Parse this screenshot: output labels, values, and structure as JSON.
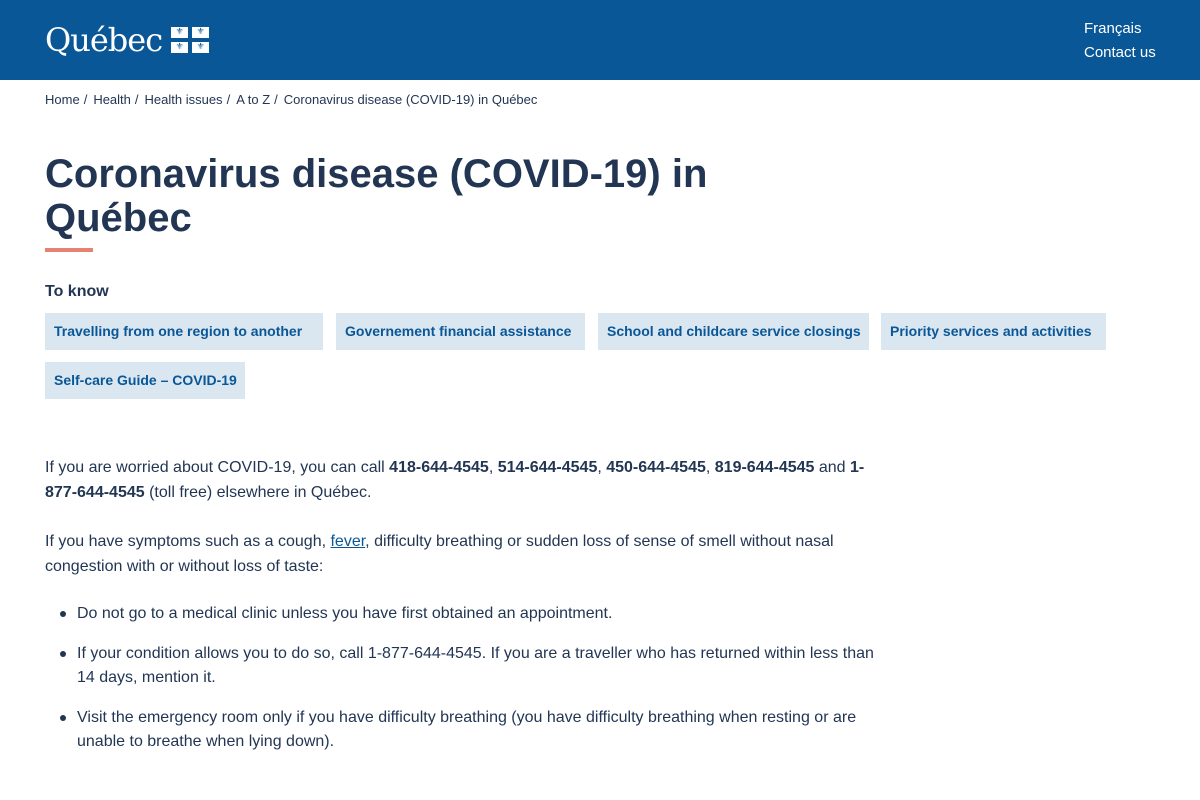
{
  "header": {
    "logo_text": "Québec",
    "links": [
      {
        "label": "Français"
      },
      {
        "label": "Contact us"
      }
    ]
  },
  "breadcrumb": [
    {
      "label": "Home"
    },
    {
      "label": "Health"
    },
    {
      "label": "Health issues"
    },
    {
      "label": "A to Z"
    },
    {
      "label": "Coronavirus disease (COVID-19) in Québec"
    }
  ],
  "breadcrumb_separator": "/",
  "page": {
    "title": "Coronavirus disease (COVID-19) in Québec",
    "to_know_heading": "To know",
    "quick_links": [
      {
        "label": "Travelling from one region to another"
      },
      {
        "label": "Governement financial assistance"
      },
      {
        "label": "School and childcare service closings"
      },
      {
        "label": "Priority services and activities"
      },
      {
        "label": "Self-care Guide – COVID-19"
      }
    ]
  },
  "body": {
    "p1": {
      "intro": "If you are worried about COVID-19, you can call ",
      "phones": [
        "418-644-4545",
        "514-644-4545",
        "450-644-4545",
        "819-644-4545",
        "1-877-644-4545"
      ],
      "and": " and ",
      "comma": ", ",
      "outro": " (toll free) elsewhere in Québec."
    },
    "p2": {
      "before_link": "If you have symptoms such as a cough, ",
      "link": "fever",
      "after_link": ", difficulty breathing or sudden loss of sense of smell without nasal congestion with or without loss of taste:"
    },
    "bullets": [
      "Do not go to a medical clinic unless you have first obtained an appointment.",
      "If your condition allows you to do so, call 1-877-644-4545. If you are a traveller who has returned within less than 14 days, mention it.",
      "Visit the emergency room only if you have difficulty breathing (you have difficulty breathing when resting or are unable to breathe when lying down)."
    ]
  },
  "colors": {
    "header_bg": "#095797",
    "text": "#223654",
    "link": "#095797",
    "chip_bg": "#dae6f0",
    "title_rule": "#e58271"
  },
  "icons": [
    "fleur-de-lis-icon"
  ]
}
